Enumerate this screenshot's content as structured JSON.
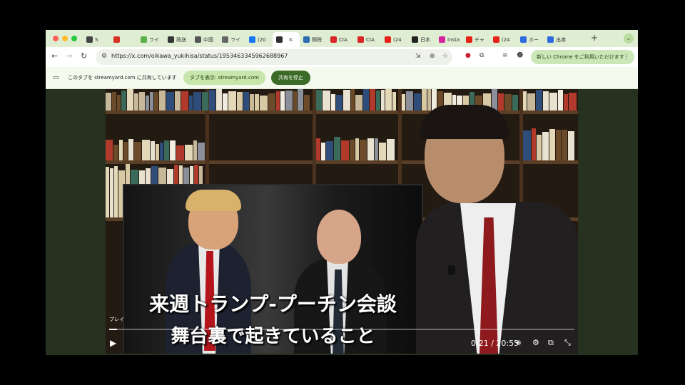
{
  "colors": {
    "tabstrip_bg": "#dfeed3",
    "share_pill": "#c6e6ab",
    "stop_btn": "#3b6b27",
    "video_bg": "#26311f"
  },
  "traffic_lights": [
    "#ff5f57",
    "#febc2e",
    "#28c840"
  ],
  "tabs": [
    {
      "icon": "s-icon",
      "color": "#444444",
      "label": "S"
    },
    {
      "icon": "record-icon",
      "color": "#d93025",
      "label": ""
    },
    {
      "icon": "play-triangle-icon",
      "color": "#5bb048",
      "label": "ライ"
    },
    {
      "icon": "briefcase-icon",
      "color": "#333333",
      "label": "政送"
    },
    {
      "icon": "stick-figure-icon",
      "color": "#555555",
      "label": "中国"
    },
    {
      "icon": "image-icon",
      "color": "#666666",
      "label": "ライ"
    },
    {
      "icon": "facebook-icon",
      "color": "#1877f2",
      "label": "(20"
    },
    {
      "icon": "streamyard-icon",
      "color": "#2f2f2f",
      "label": "",
      "active": true
    },
    {
      "icon": "c-icon",
      "color": "#2b6cb0",
      "label": "関税"
    },
    {
      "icon": "yahoo-icon",
      "color": "#d92626",
      "label": "CIA"
    },
    {
      "icon": "yahoo-icon",
      "color": "#d92626",
      "label": "CIA"
    },
    {
      "icon": "youtube-icon",
      "color": "#e62117",
      "label": "(24"
    },
    {
      "icon": "nikkei-icon",
      "color": "#222222",
      "label": "日本"
    },
    {
      "icon": "instagram-icon",
      "color": "#d6249f",
      "label": "Insta"
    },
    {
      "icon": "youtube-icon",
      "color": "#e62117",
      "label": "チャ"
    },
    {
      "icon": "youtube-icon",
      "color": "#e62117",
      "label": "(24"
    },
    {
      "icon": "zoom-icon",
      "color": "#2d6cdf",
      "label": "ホー"
    },
    {
      "icon": "zoom-icon",
      "color": "#2d6cdf",
      "label": "出席"
    }
  ],
  "toolbar": {
    "url": "https://x.com/oikawa_yukihisa/status/1953463345962688967",
    "update_label": "新しい Chrome をご利用いただけます"
  },
  "sharebar": {
    "message": "このタブを streamyard.com に共有しています",
    "show_tab_label": "タブを表示: streamyard.com",
    "stop_label": "共有を停止"
  },
  "video": {
    "caption_line1": "来週トランプ-プーチン会談",
    "caption_line2": "舞台裏で起きていること",
    "play_label": "プレイ",
    "time": "0:21 / 20:55",
    "progress_fraction": 0.017
  }
}
